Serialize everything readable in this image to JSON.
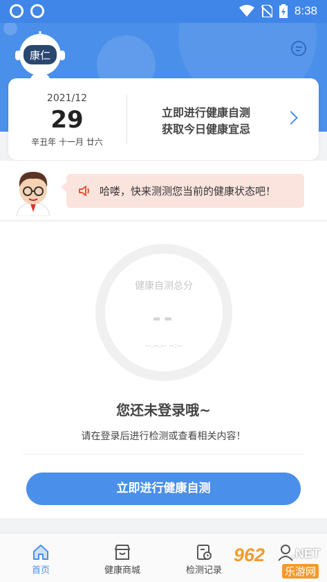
{
  "status_bar": {
    "time": "8:38"
  },
  "header": {
    "robot_badge": "康仁"
  },
  "date_card": {
    "year_month": "2021/12",
    "day": "29",
    "lunar": "辛丑年 十一月 廿六",
    "cta_line1": "立即进行健康自测",
    "cta_line2": "获取今日健康宜忌"
  },
  "tip": {
    "text": "哈喽，快来测测您当前的健康状态吧！"
  },
  "score": {
    "label": "健康自测总分",
    "value": "--",
    "date": "--.--.-- --:--"
  },
  "login": {
    "title": "您还未登录哦~",
    "subtitle": "请在登录后进行检测或查看相关内容！",
    "button": "立即进行健康自测"
  },
  "bottom_nav": {
    "items": [
      {
        "label": "首页",
        "icon": "home-icon",
        "active": true
      },
      {
        "label": "健康商城",
        "icon": "store-icon",
        "active": false
      },
      {
        "label": "检测记录",
        "icon": "record-icon",
        "active": false
      },
      {
        "label": "",
        "icon": "profile-icon",
        "active": false
      }
    ]
  },
  "watermark": {
    "brand": "962",
    "tld": ".NET",
    "site": "乐游网"
  },
  "colors": {
    "primary": "#4a8fe9",
    "tip_bg": "#fbe4dd",
    "accent": "#f39a2c"
  }
}
